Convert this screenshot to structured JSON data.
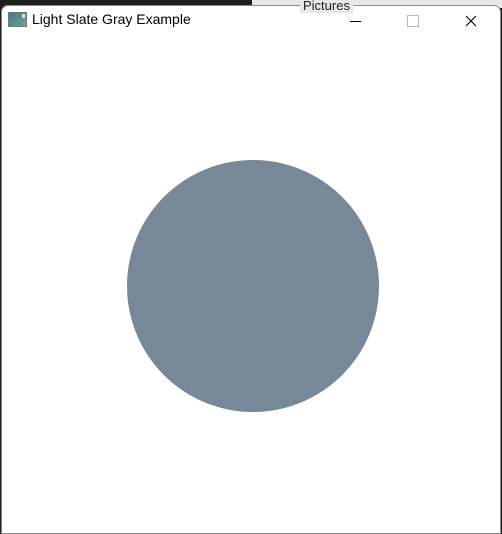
{
  "window": {
    "title": "Light Slate Gray Example"
  },
  "background": {
    "partial_text": "Pictures"
  },
  "canvas": {
    "circle_color": "#778899",
    "circle_name": "Light Slate Gray"
  }
}
